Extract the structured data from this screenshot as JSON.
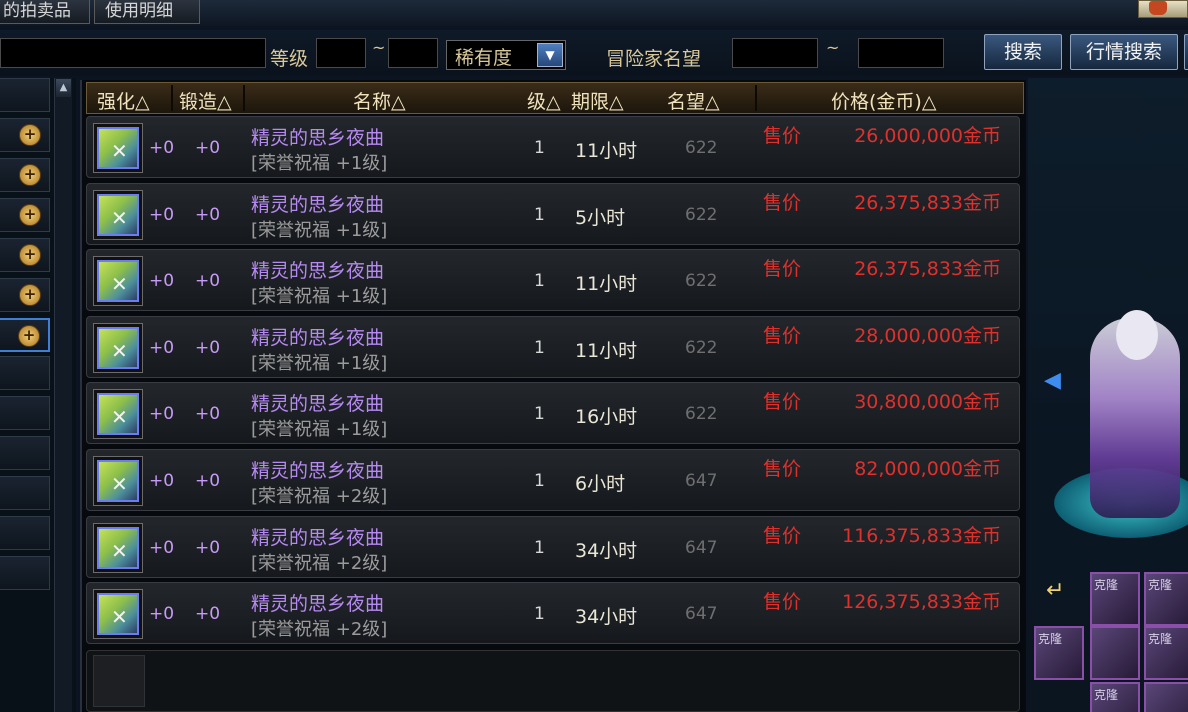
{
  "tabs": [
    {
      "label": "的拍卖品"
    },
    {
      "label": "使用明细"
    }
  ],
  "search": {
    "level_label": "等级",
    "level_range_sep": "~",
    "rarity_value": "稀有度",
    "adventurer_label": "冒险家名望",
    "fame_range_sep": "~",
    "search_button": "搜索",
    "market_search_button": "行情搜索"
  },
  "table": {
    "headers": {
      "enhance": "强化△",
      "forge": "锻造△",
      "name": "名称△",
      "level": "级△",
      "duration": "期限△",
      "fame": "名望△",
      "price": "价格(金币)△"
    },
    "rows": [
      {
        "enhance": "+0",
        "forge": "+0",
        "name": "精灵的思乡夜曲",
        "sub": "[荣誉祝福 +1级]",
        "level": "1",
        "duration": "11小时",
        "fame": "622",
        "sale_label": "售价",
        "price": "26,000,000金币"
      },
      {
        "enhance": "+0",
        "forge": "+0",
        "name": "精灵的思乡夜曲",
        "sub": "[荣誉祝福 +1级]",
        "level": "1",
        "duration": "5小时",
        "fame": "622",
        "sale_label": "售价",
        "price": "26,375,833金币"
      },
      {
        "enhance": "+0",
        "forge": "+0",
        "name": "精灵的思乡夜曲",
        "sub": "[荣誉祝福 +1级]",
        "level": "1",
        "duration": "11小时",
        "fame": "622",
        "sale_label": "售价",
        "price": "26,375,833金币"
      },
      {
        "enhance": "+0",
        "forge": "+0",
        "name": "精灵的思乡夜曲",
        "sub": "[荣誉祝福 +1级]",
        "level": "1",
        "duration": "11小时",
        "fame": "622",
        "sale_label": "售价",
        "price": "28,000,000金币"
      },
      {
        "enhance": "+0",
        "forge": "+0",
        "name": "精灵的思乡夜曲",
        "sub": "[荣誉祝福 +1级]",
        "level": "1",
        "duration": "16小时",
        "fame": "622",
        "sale_label": "售价",
        "price": "30,800,000金币"
      },
      {
        "enhance": "+0",
        "forge": "+0",
        "name": "精灵的思乡夜曲",
        "sub": "[荣誉祝福 +2级]",
        "level": "1",
        "duration": "6小时",
        "fame": "647",
        "sale_label": "售价",
        "price": "82,000,000金币"
      },
      {
        "enhance": "+0",
        "forge": "+0",
        "name": "精灵的思乡夜曲",
        "sub": "[荣誉祝福 +2级]",
        "level": "1",
        "duration": "34小时",
        "fame": "647",
        "sale_label": "售价",
        "price": "116,375,833金币"
      },
      {
        "enhance": "+0",
        "forge": "+0",
        "name": "精灵的思乡夜曲",
        "sub": "[荣誉祝福 +2级]",
        "level": "1",
        "duration": "34小时",
        "fame": "647",
        "sale_label": "售价",
        "price": "126,375,833金币"
      }
    ]
  },
  "side": {
    "cells": [
      "克隆",
      "克隆",
      "克隆",
      "克隆",
      "克隆"
    ]
  }
}
